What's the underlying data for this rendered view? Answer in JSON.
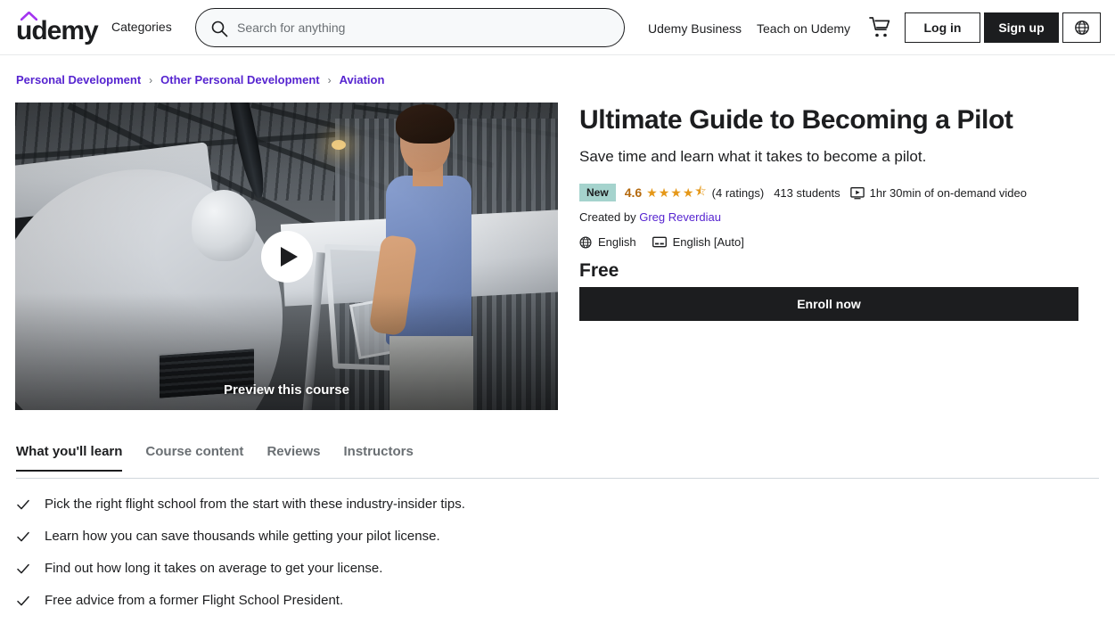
{
  "header": {
    "logo_text": "udemy",
    "logo_accent_color": "#a435f0",
    "categories_label": "Categories",
    "search": {
      "placeholder": "Search for anything",
      "value": ""
    },
    "nav_links": [
      {
        "label": "Udemy Business"
      },
      {
        "label": "Teach on Udemy"
      }
    ],
    "cart_icon": "shopping-cart-icon",
    "login_label": "Log in",
    "signup_label": "Sign up",
    "language_icon": "globe-icon"
  },
  "breadcrumb": {
    "separator": "›",
    "items": [
      {
        "label": "Personal Development"
      },
      {
        "label": "Other Personal Development"
      },
      {
        "label": "Aviation"
      }
    ],
    "link_color": "#5624d0"
  },
  "video": {
    "preview_label": "Preview this course",
    "play_icon": "play-icon",
    "alt": "Man in blue polo shirt beside a white single-engine airplane inside a hangar"
  },
  "course": {
    "title": "Ultimate Guide to Becoming a Pilot",
    "subtitle": "Save time and learn what it takes to become a pilot.",
    "badge": "New",
    "badge_color": "#a5d3cd",
    "rating": "4.6",
    "rating_color": "#b4690e",
    "star_color": "#e59819",
    "stars": [
      "★",
      "★",
      "★",
      "★",
      "⯪"
    ],
    "ratings_count": "(4 ratings)",
    "students": "413 students",
    "duration": "1hr 30min of on-demand video",
    "duration_icon": "video-monitor-icon",
    "created_by_label": "Created by",
    "instructor": "Greg Reverdiau",
    "instructor_color": "#5624d0",
    "language": "English",
    "language_icon": "globe-icon",
    "captions": "English [Auto]",
    "captions_icon": "closed-caption-icon",
    "price": "Free",
    "enroll_label": "Enroll now"
  },
  "tabs": [
    {
      "label": "What you'll learn",
      "active": true
    },
    {
      "label": "Course content",
      "active": false
    },
    {
      "label": "Reviews",
      "active": false
    },
    {
      "label": "Instructors",
      "active": false
    }
  ],
  "learn": {
    "items": [
      {
        "text": "Pick the right flight school from the start with these industry-insider tips."
      },
      {
        "text": "Learn how you can save thousands while getting your pilot license."
      },
      {
        "text": "Find out how long it takes on average to get your license."
      },
      {
        "text": "Free advice from a former Flight School President."
      }
    ]
  }
}
